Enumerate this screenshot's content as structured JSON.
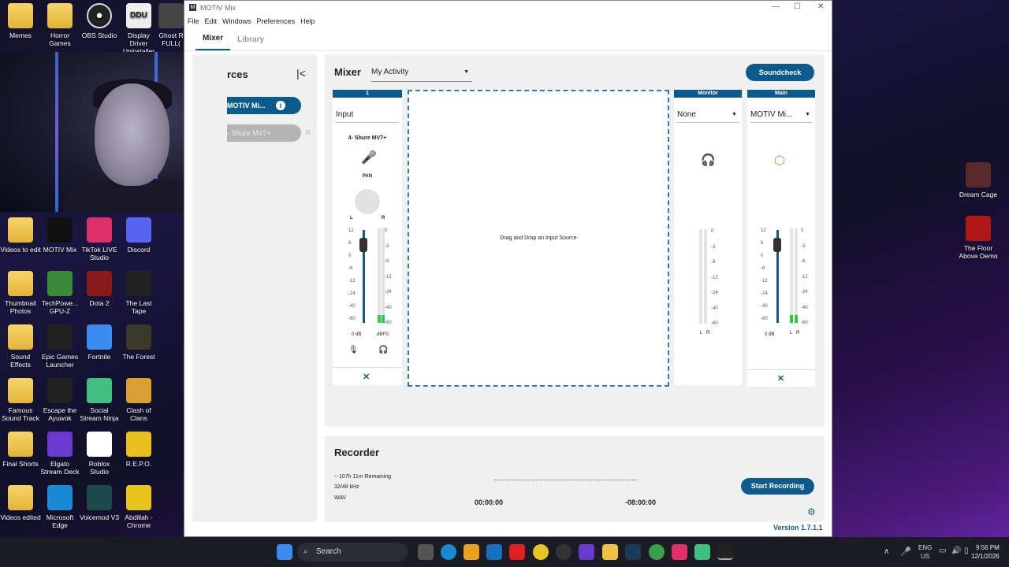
{
  "desktop": {
    "top_icons": [
      "Memes",
      "Horror Games",
      "OBS Studio",
      "Display Driver Uninstaller",
      "Ghost R FULL("
    ],
    "grid": [
      {
        "label": "Videos to edit",
        "icon": "folder-icon"
      },
      {
        "label": "MOTIV Mix",
        "icon": "motiv-icon"
      },
      {
        "label": "TikTok LIVE Studio",
        "icon": "tiktok-icon"
      },
      {
        "label": "Discord",
        "icon": "discord-icon"
      },
      {
        "label": "Thumbnail Photos",
        "icon": "folder-icon"
      },
      {
        "label": "TechPowe... GPU-Z",
        "icon": "gpuz-icon"
      },
      {
        "label": "Dota 2",
        "icon": "dota-icon"
      },
      {
        "label": "The Last Tape",
        "icon": "game-icon"
      },
      {
        "label": "Sound Effects",
        "icon": "folder-icon"
      },
      {
        "label": "Epic Games Launcher",
        "icon": "epic-icon"
      },
      {
        "label": "Fortnite",
        "icon": "fortnite-icon"
      },
      {
        "label": "The Forest",
        "icon": "forest-icon"
      },
      {
        "label": "Famous Sound Track",
        "icon": "folder-icon"
      },
      {
        "label": "Escape the Ayuwok",
        "icon": "game-icon"
      },
      {
        "label": "Social Stream Ninja",
        "icon": "ninja-icon"
      },
      {
        "label": "Clash of Clans",
        "icon": "coc-icon"
      },
      {
        "label": "Final Shorts",
        "icon": "folder-icon"
      },
      {
        "label": "Elgato Stream Deck",
        "icon": "streamdeck-icon"
      },
      {
        "label": "Roblox Studio",
        "icon": "roblox-icon"
      },
      {
        "label": "R.E.P.O.",
        "icon": "repo-icon"
      },
      {
        "label": "Videos edited",
        "icon": "folder-icon"
      },
      {
        "label": "Microsoft Edge",
        "icon": "edge-icon"
      },
      {
        "label": "Voicemod V3",
        "icon": "voicemod-icon"
      },
      {
        "label": "Abdillah - Chrome",
        "icon": "chrome-icon"
      }
    ],
    "right_icons": [
      "Dream Cage",
      "The Floor Above Demo"
    ]
  },
  "app": {
    "title": "MOTIV Mix",
    "menu": [
      "File",
      "Edit",
      "Windows",
      "Preferences",
      "Help"
    ],
    "tabs": [
      "Mixer",
      "Library"
    ],
    "sources": {
      "heading": "rces",
      "item_active": "MOTIV Mi...",
      "item_other": "- Shure MV7+"
    },
    "mixer": {
      "title": "Mixer",
      "activity": "My Activity",
      "soundcheck": "Soundcheck",
      "strip1": {
        "header": "1",
        "input": "Input",
        "device": "4- Shure MV7+",
        "pan": "PAN",
        "pan_l": "L",
        "pan_r": "R",
        "fader_ticks": [
          "12",
          "6",
          "0",
          "-6",
          "-12",
          "-24",
          "-40",
          "-60"
        ],
        "meter_ticks": [
          "0",
          "-3",
          "-6",
          "-12",
          "-24",
          "-40",
          "-60"
        ],
        "db": "0 dB",
        "dbfs": "dBFS"
      },
      "drop_text": "Drag and Drop an Input Source",
      "monitor": {
        "header": "Monitor",
        "value": "None",
        "l": "L",
        "r": "R",
        "meter_ticks": [
          "0",
          "-3",
          "-6",
          "-12",
          "-24",
          "-40",
          "-60"
        ]
      },
      "main": {
        "header": "Main",
        "value": "MOTIV Mi...",
        "db": "0 dB",
        "l": "L",
        "r": "R",
        "fader_ticks": [
          "12",
          "6",
          "0",
          "-6",
          "-12",
          "-24",
          "-40",
          "-60"
        ],
        "meter_ticks": [
          "0",
          "-3",
          "-6",
          "-12",
          "-24",
          "-40",
          "-60"
        ]
      }
    },
    "recorder": {
      "title": "Recorder",
      "remaining": "~ 107h 11m Remaining",
      "format": "32/48 kHz",
      "type": "WAV",
      "time_start": "00:00:00",
      "time_end": "-08:00:00",
      "start": "Start Recording"
    },
    "version": "Version 1.7.1.1"
  },
  "taskbar": {
    "search": "Search",
    "lang": "ENG",
    "region": "US",
    "time": "9:56 PM",
    "date": "12/1/2026"
  }
}
